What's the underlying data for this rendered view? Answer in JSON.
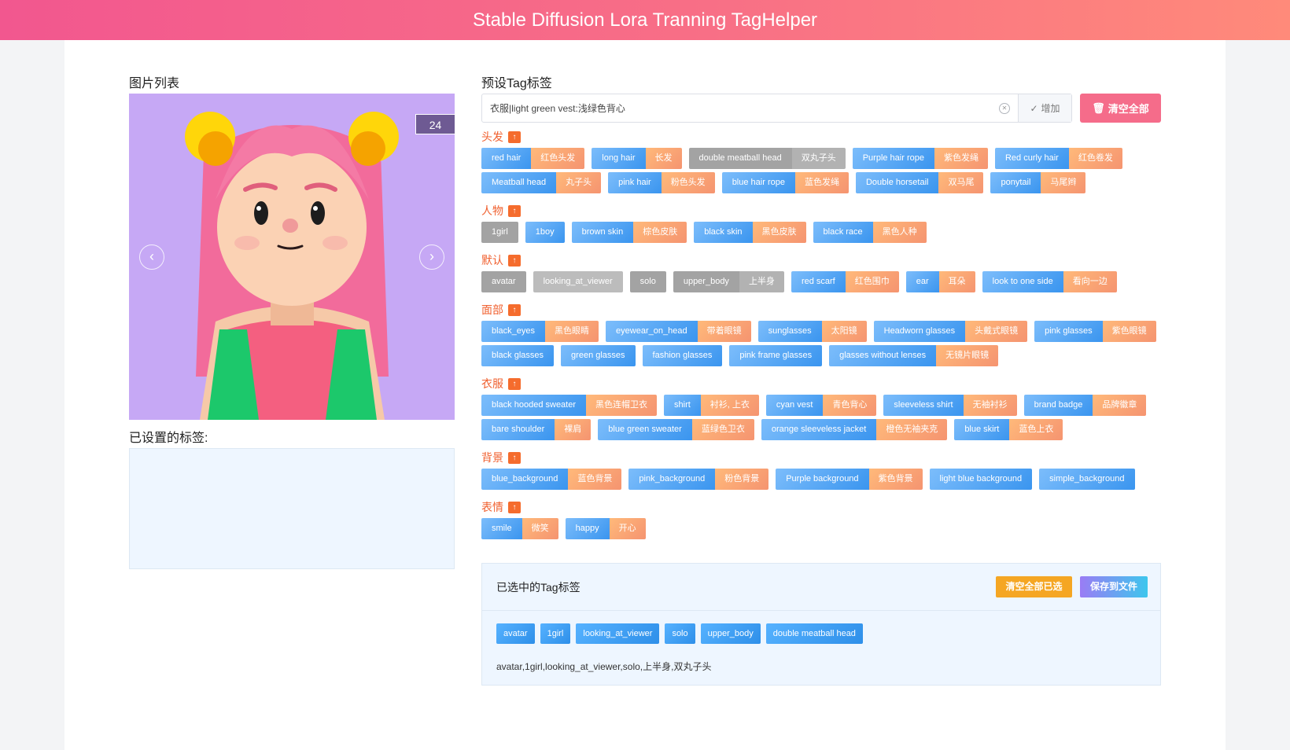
{
  "app": {
    "title": "Stable Diffusion Lora Tranning TagHelper"
  },
  "image_list": {
    "title": "图片列表",
    "count": "24",
    "prev": "‹",
    "next": "›"
  },
  "tags_set": {
    "title": "已设置的标签:"
  },
  "preset": {
    "title": "预设Tag标签",
    "input_value": "衣服|light green vest:浅绿色背心",
    "add_label": "增加",
    "clear_all_label": "清空全部"
  },
  "categories": [
    {
      "name": "头发",
      "rows": [
        [
          {
            "en": "red hair",
            "zh": "红色头发"
          },
          {
            "en": "long hair",
            "zh": "长发"
          },
          {
            "en": "double meatball head",
            "zh": "双丸子头",
            "style": "grey"
          },
          {
            "en": "Purple hair rope",
            "zh": "紫色发绳"
          },
          {
            "en": "Red curly hair",
            "zh": "红色卷发"
          }
        ],
        [
          {
            "en": "Meatball head",
            "zh": "丸子头"
          },
          {
            "en": "pink hair",
            "zh": "粉色头发"
          },
          {
            "en": "blue hair rope",
            "zh": "蓝色发绳"
          },
          {
            "en": "Double horsetail",
            "zh": "双马尾"
          },
          {
            "en": "ponytail",
            "zh": "马尾辫"
          }
        ]
      ]
    },
    {
      "name": "人物",
      "rows": [
        [
          {
            "en": "1girl",
            "style": "grey"
          },
          {
            "en": "1boy"
          },
          {
            "en": "brown skin",
            "zh": "棕色皮肤"
          },
          {
            "en": "black skin",
            "zh": "黑色皮肤"
          },
          {
            "en": "black race",
            "zh": "黑色人种"
          }
        ]
      ]
    },
    {
      "name": "默认",
      "rows": [
        [
          {
            "en": "avatar",
            "style": "grey"
          },
          {
            "en": "looking_at_viewer",
            "style": "grey2"
          },
          {
            "en": "solo",
            "style": "grey"
          },
          {
            "en": "upper_body",
            "zh": "上半身",
            "style": "grey"
          },
          {
            "en": "red scarf",
            "zh": "红色围巾"
          },
          {
            "en": "ear",
            "zh": "耳朵"
          },
          {
            "en": "look to one side",
            "zh": "看向一边"
          }
        ]
      ]
    },
    {
      "name": "面部",
      "rows": [
        [
          {
            "en": "black_eyes",
            "zh": "黑色眼睛"
          },
          {
            "en": "eyewear_on_head",
            "zh": "带着眼镜"
          },
          {
            "en": "sunglasses",
            "zh": "太阳镜"
          },
          {
            "en": "Headworn glasses",
            "zh": "头戴式眼镜"
          },
          {
            "en": "pink glasses",
            "zh": "紫色眼镜"
          }
        ],
        [
          {
            "en": "black glasses"
          },
          {
            "en": "green glasses"
          },
          {
            "en": "fashion glasses"
          },
          {
            "en": "pink frame glasses"
          },
          {
            "en": "glasses without lenses",
            "zh": "无镜片眼镜"
          }
        ]
      ]
    },
    {
      "name": "衣服",
      "rows": [
        [
          {
            "en": "black hooded sweater",
            "zh": "黑色连帽卫衣"
          },
          {
            "en": "shirt",
            "zh": "衬衫, 上衣"
          },
          {
            "en": "cyan vest",
            "zh": "青色背心"
          },
          {
            "en": "sleeveless shirt",
            "zh": "无袖衬衫"
          },
          {
            "en": "brand badge",
            "zh": "品牌徽章"
          }
        ],
        [
          {
            "en": "bare shoulder",
            "zh": "裸肩"
          },
          {
            "en": "blue green sweater",
            "zh": "蓝绿色卫衣"
          },
          {
            "en": "orange sleeveless jacket",
            "zh": "橙色无袖夹克"
          },
          {
            "en": "blue skirt",
            "zh": "蓝色上衣"
          }
        ]
      ]
    },
    {
      "name": "背景",
      "rows": [
        [
          {
            "en": "blue_background",
            "zh": "蓝色背景"
          },
          {
            "en": "pink_background",
            "zh": "粉色背景"
          },
          {
            "en": "Purple background",
            "zh": "紫色背景"
          },
          {
            "en": "light blue background"
          },
          {
            "en": "simple_background"
          }
        ]
      ]
    },
    {
      "name": "表情",
      "rows": [
        [
          {
            "en": "smile",
            "zh": "微笑"
          },
          {
            "en": "happy",
            "zh": "开心"
          }
        ]
      ]
    }
  ],
  "selected": {
    "title": "已选中的Tag标签",
    "clear_label": "清空全部已选",
    "save_label": "保存到文件",
    "chips": [
      "avatar",
      "1girl",
      "looking_at_viewer",
      "solo",
      "upper_body",
      "double meatball head"
    ],
    "text": "avatar,1girl,looking_at_viewer,solo,上半身,双丸子头"
  }
}
